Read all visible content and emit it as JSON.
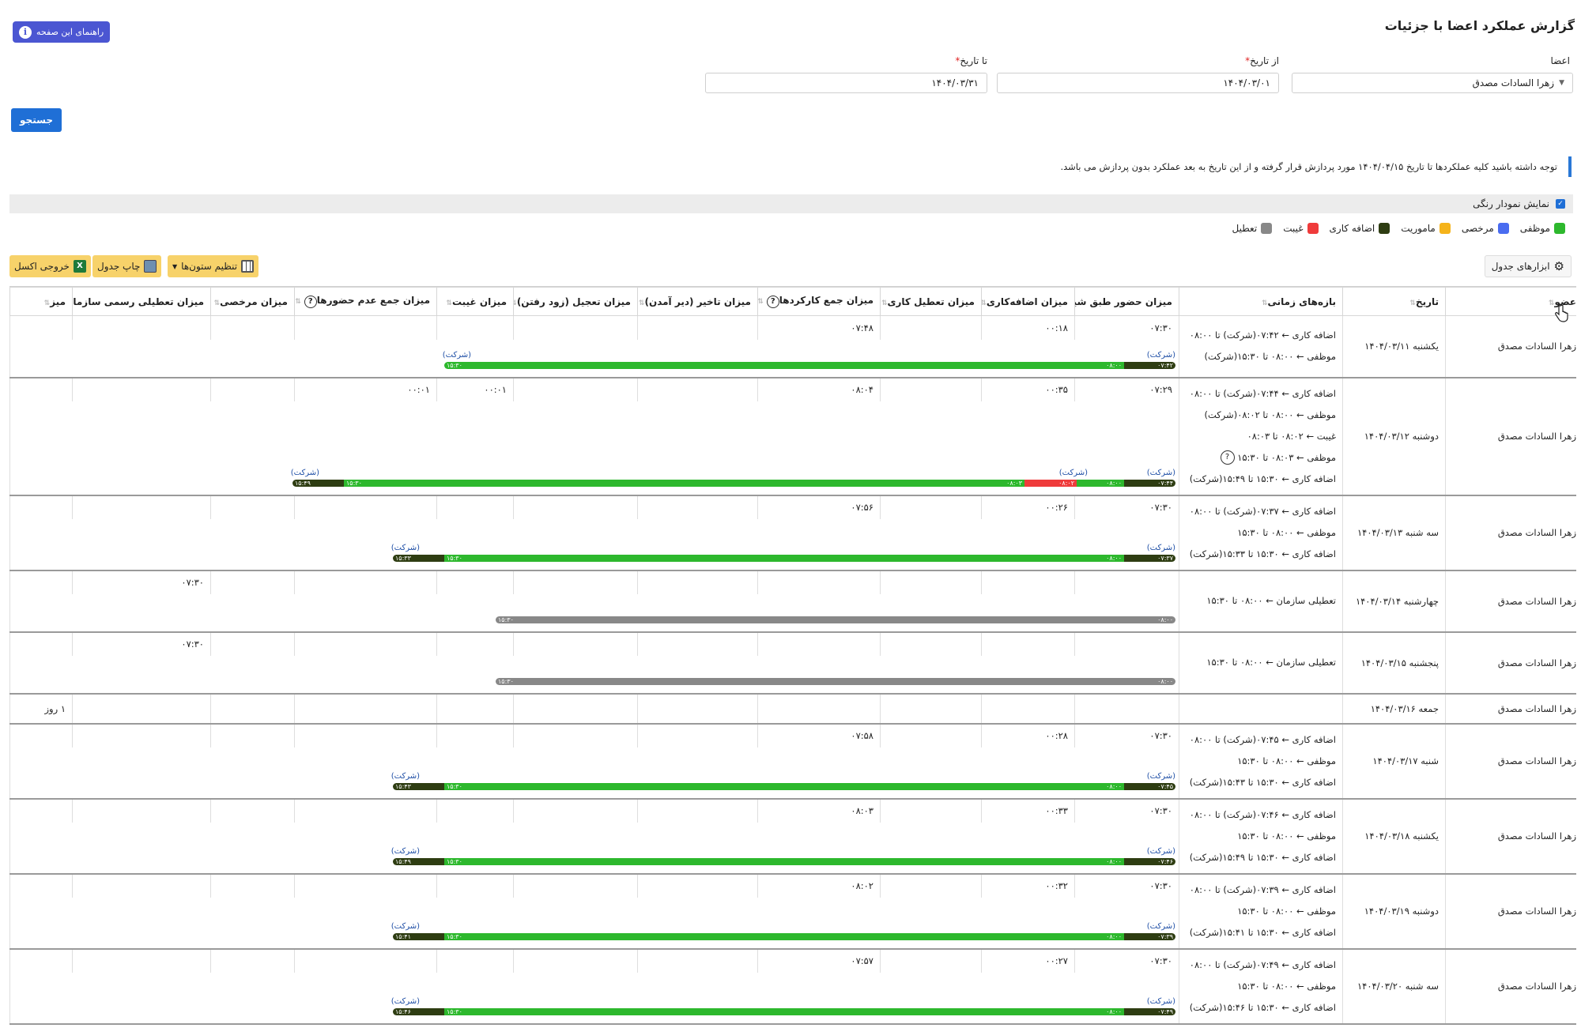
{
  "page": {
    "title": "گزارش عملکرد اعضا با جزئیات",
    "help_label": "راهنمای این صفحه"
  },
  "filters": {
    "members_label": "اعضا",
    "member_value": "زهرا السادات مصدق",
    "from_label": "از تاریخ",
    "from_value": "۱۴۰۴/۰۳/۰۱",
    "to_label": "تا تاریخ",
    "to_value": "۱۴۰۴/۰۳/۳۱",
    "search_label": "جستجو"
  },
  "notice": "توجه داشته باشید کلیه عملکردها تا تاریخ ۱۴۰۴/۰۴/۱۵ مورد پردازش قرار گرفته و از این تاریخ به بعد عملکرد بدون پردازش می باشد.",
  "color_chart_label": "نمایش نمودار رنگی",
  "legend": [
    {
      "label": "موظفی",
      "color": "#2db82d"
    },
    {
      "label": "مرخصی",
      "color": "#4a6cf0"
    },
    {
      "label": "ماموریت",
      "color": "#f5b31a"
    },
    {
      "label": "اضافه کاری",
      "color": "#2e3d12"
    },
    {
      "label": "غیبت",
      "color": "#ef3b3b"
    },
    {
      "label": "تعطیل",
      "color": "#888888"
    }
  ],
  "toolbar": {
    "table_tools": "ابزارهای جدول",
    "column_settings": "تنظیم ستون‌ها",
    "print_table": "چاپ جدول",
    "excel_export": "خروجی اکسل"
  },
  "columns": [
    "عضو",
    "تاریخ",
    "بازه‌های زمانی",
    "میزان حضور طبق شیفت",
    "میزان اضافه‌کاری",
    "میزان تعطیل کاری",
    "میزان جمع کارکردها",
    "میزان تاخیر (دیر آمدن)",
    "میزان تعجیل (زود رفتن)",
    "میزان غیبت",
    "میزان جمع عدم حضورها",
    "میزان مرخصی",
    "میزان تعطیلی رسمی سازمان",
    "میز"
  ],
  "company": "(شرکت)",
  "rows": [
    {
      "member": "زهرا السادات مصدق",
      "date": "یکشنبه ۱۴۰۴/۰۳/۱۱",
      "intervals": [
        "اضافه کاری ← ۰۷:۴۲(شرکت) تا ۰۸:۰۰",
        "موظفی ← ۰۸:۰۰ تا ۱۵:۳۰(شرکت)"
      ],
      "attendance": "۰۷:۳۰",
      "overtime": "۰۰:۱۸",
      "holiday_work": "",
      "total_work": "۰۷:۴۸",
      "delay": "",
      "early": "",
      "absence": "",
      "total_absence": "",
      "leave": "",
      "official_holiday": "",
      "last": "",
      "timeline": {
        "segs": [
          {
            "t": "ot",
            "l": "۰۷:۴۲"
          },
          {
            "t": "duty",
            "l": "۰۸:۰۰",
            "r": "۱۵:۳۰"
          }
        ]
      }
    },
    {
      "member": "زهرا السادات مصدق",
      "date": "دوشنبه ۱۴۰۴/۰۳/۱۲",
      "intervals": [
        "اضافه کاری ← ۰۷:۴۴(شرکت) تا ۰۸:۰۰",
        "موظفی ← ۰۸:۰۰ تا ۰۸:۰۲(شرکت)",
        "غیبت ← ۰۸:۰۲ تا ۰۸:۰۳",
        "موظفی ← ۰۸:۰۳ تا ۱۵:۳۰",
        "اضافه کاری ← ۱۵:۳۰ تا ۱۵:۴۹(شرکت)"
      ],
      "attendance": "۰۷:۲۹",
      "overtime": "۰۰:۳۵",
      "holiday_work": "",
      "total_work": "۰۸:۰۴",
      "delay": "",
      "early": "",
      "absence": "۰۰:۰۱",
      "total_absence": "۰۰:۰۱",
      "leave": "",
      "official_holiday": "",
      "last": "",
      "timeline": {
        "segs": [
          {
            "t": "ot",
            "l": "۰۷:۴۴"
          },
          {
            "t": "duty",
            "l": "۰۸:۰۰"
          },
          {
            "t": "abs",
            "l": "۰۸:۰۲"
          },
          {
            "t": "duty",
            "l": "۰۸:۰۳",
            "r": "۱۵:۳۰"
          },
          {
            "t": "ot",
            "r": "۱۵:۴۹"
          }
        ]
      }
    },
    {
      "member": "زهرا السادات مصدق",
      "date": "سه شنبه ۱۴۰۴/۰۳/۱۳",
      "intervals": [
        "اضافه کاری ← ۰۷:۳۷(شرکت) تا ۰۸:۰۰",
        "موظفی ← ۰۸:۰۰ تا ۱۵:۳۰",
        "اضافه کاری ← ۱۵:۳۰ تا ۱۵:۳۳(شرکت)"
      ],
      "attendance": "۰۷:۳۰",
      "overtime": "۰۰:۲۶",
      "holiday_work": "",
      "total_work": "۰۷:۵۶",
      "delay": "",
      "early": "",
      "absence": "",
      "total_absence": "",
      "leave": "",
      "official_holiday": "",
      "last": "",
      "timeline": {
        "segs": [
          {
            "t": "ot",
            "l": "۰۷:۳۷"
          },
          {
            "t": "duty",
            "l": "۰۸:۰۰",
            "r": "۱۵:۳۰"
          },
          {
            "t": "ot",
            "r": "۱۵:۳۳"
          }
        ]
      }
    },
    {
      "member": "زهرا السادات مصدق",
      "date": "چهارشنبه ۱۴۰۴/۰۳/۱۴",
      "intervals": [
        "تعطیلی سازمان ← ۰۸:۰۰ تا ۱۵:۳۰"
      ],
      "attendance": "",
      "overtime": "",
      "holiday_work": "",
      "total_work": "",
      "delay": "",
      "early": "",
      "absence": "",
      "total_absence": "",
      "leave": "",
      "official_holiday": "۰۷:۳۰",
      "last": "",
      "timeline": {
        "segs": [
          {
            "t": "hol",
            "l": "۰۸:۰۰",
            "r": "۱۵:۳۰"
          }
        ]
      }
    },
    {
      "member": "زهرا السادات مصدق",
      "date": "پنجشنبه ۱۴۰۴/۰۳/۱۵",
      "intervals": [
        "تعطیلی سازمان ← ۰۸:۰۰ تا ۱۵:۳۰"
      ],
      "attendance": "",
      "overtime": "",
      "holiday_work": "",
      "total_work": "",
      "delay": "",
      "early": "",
      "absence": "",
      "total_absence": "",
      "leave": "",
      "official_holiday": "۰۷:۳۰",
      "last": "",
      "timeline": {
        "segs": [
          {
            "t": "hol",
            "l": "۰۸:۰۰",
            "r": "۱۵:۳۰"
          }
        ]
      }
    },
    {
      "member": "زهرا السادات مصدق",
      "date": "جمعه ۱۴۰۴/۰۳/۱۶",
      "intervals": [],
      "attendance": "",
      "overtime": "",
      "holiday_work": "",
      "total_work": "",
      "delay": "",
      "early": "",
      "absence": "",
      "total_absence": "",
      "leave": "",
      "official_holiday": "",
      "last": "۱ روز",
      "timeline": null
    },
    {
      "member": "زهرا السادات مصدق",
      "date": "شنبه ۱۴۰۴/۰۳/۱۷",
      "intervals": [
        "اضافه کاری ← ۰۷:۴۵(شرکت) تا ۰۸:۰۰",
        "موظفی ← ۰۸:۰۰ تا ۱۵:۳۰",
        "اضافه کاری ← ۱۵:۳۰ تا ۱۵:۴۳(شرکت)"
      ],
      "attendance": "۰۷:۳۰",
      "overtime": "۰۰:۲۸",
      "holiday_work": "",
      "total_work": "۰۷:۵۸",
      "delay": "",
      "early": "",
      "absence": "",
      "total_absence": "",
      "leave": "",
      "official_holiday": "",
      "last": "",
      "timeline": {
        "segs": [
          {
            "t": "ot",
            "l": "۰۷:۴۵"
          },
          {
            "t": "duty",
            "l": "۰۸:۰۰",
            "r": "۱۵:۳۰"
          },
          {
            "t": "ot",
            "r": "۱۵:۴۳"
          }
        ]
      }
    },
    {
      "member": "زهرا السادات مصدق",
      "date": "یکشنبه ۱۴۰۴/۰۳/۱۸",
      "intervals": [
        "اضافه کاری ← ۰۷:۴۶(شرکت) تا ۰۸:۰۰",
        "موظفی ← ۰۸:۰۰ تا ۱۵:۳۰",
        "اضافه کاری ← ۱۵:۳۰ تا ۱۵:۴۹(شرکت)"
      ],
      "attendance": "۰۷:۳۰",
      "overtime": "۰۰:۳۳",
      "holiday_work": "",
      "total_work": "۰۸:۰۳",
      "delay": "",
      "early": "",
      "absence": "",
      "total_absence": "",
      "leave": "",
      "official_holiday": "",
      "last": "",
      "timeline": {
        "segs": [
          {
            "t": "ot",
            "l": "۰۷:۴۶"
          },
          {
            "t": "duty",
            "l": "۰۸:۰۰",
            "r": "۱۵:۳۰"
          },
          {
            "t": "ot",
            "r": "۱۵:۴۹"
          }
        ]
      }
    },
    {
      "member": "زهرا السادات مصدق",
      "date": "دوشنبه ۱۴۰۴/۰۳/۱۹",
      "intervals": [
        "اضافه کاری ← ۰۷:۳۹(شرکت) تا ۰۸:۰۰",
        "موظفی ← ۰۸:۰۰ تا ۱۵:۳۰",
        "اضافه کاری ← ۱۵:۳۰ تا ۱۵:۴۱(شرکت)"
      ],
      "attendance": "۰۷:۳۰",
      "overtime": "۰۰:۳۲",
      "holiday_work": "",
      "total_work": "۰۸:۰۲",
      "delay": "",
      "early": "",
      "absence": "",
      "total_absence": "",
      "leave": "",
      "official_holiday": "",
      "last": "",
      "timeline": {
        "segs": [
          {
            "t": "ot",
            "l": "۰۷:۳۹"
          },
          {
            "t": "duty",
            "l": "۰۸:۰۰",
            "r": "۱۵:۳۰"
          },
          {
            "t": "ot",
            "r": "۱۵:۴۱"
          }
        ]
      }
    },
    {
      "member": "زهرا السادات مصدق",
      "date": "سه شنبه ۱۴۰۴/۰۳/۲۰",
      "intervals": [
        "اضافه کاری ← ۰۷:۴۹(شرکت) تا ۰۸:۰۰",
        "موظفی ← ۰۸:۰۰ تا ۱۵:۳۰",
        "اضافه کاری ← ۱۵:۳۰ تا ۱۵:۴۶(شرکت)"
      ],
      "attendance": "۰۷:۳۰",
      "overtime": "۰۰:۲۷",
      "holiday_work": "",
      "total_work": "۰۷:۵۷",
      "delay": "",
      "early": "",
      "absence": "",
      "total_absence": "",
      "leave": "",
      "official_holiday": "",
      "last": "",
      "timeline": {
        "segs": [
          {
            "t": "ot",
            "l": "۰۷:۴۹"
          },
          {
            "t": "duty",
            "l": "۰۸:۰۰",
            "r": "۱۵:۳۰"
          },
          {
            "t": "ot",
            "r": "۱۵:۴۶"
          }
        ]
      }
    }
  ]
}
